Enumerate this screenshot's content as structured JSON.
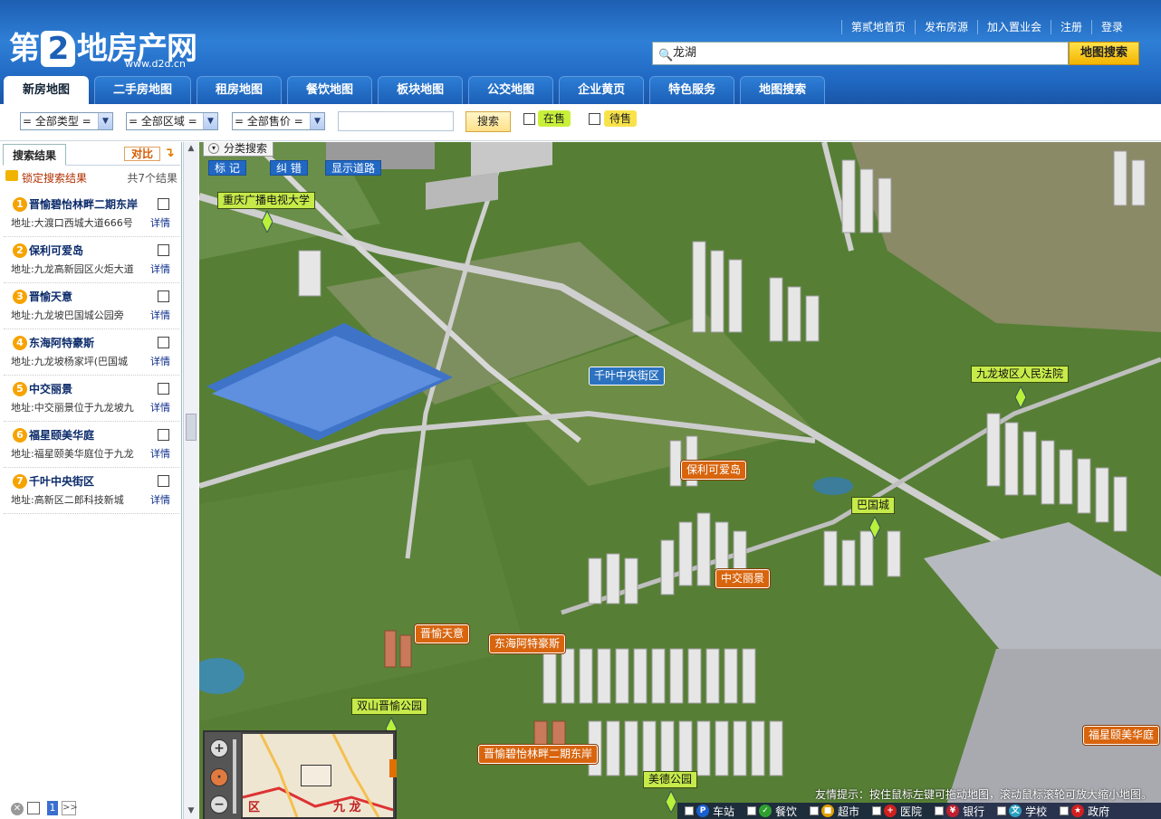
{
  "header": {
    "logo_text_left": "第",
    "logo_text_two": "2",
    "logo_text_right": "地房产网",
    "logo_url": "www.d2d.cn",
    "top_links": [
      "第贰地首页",
      "发布房源",
      "加入置业会",
      "注册",
      "登录"
    ],
    "search_value": "龙湖",
    "search_button": "地图搜索"
  },
  "tabs": [
    {
      "label": "新房地图",
      "active": true
    },
    {
      "label": "二手房地图",
      "active": false
    },
    {
      "label": "租房地图",
      "active": false
    },
    {
      "label": "餐饮地图",
      "active": false
    },
    {
      "label": "板块地图",
      "active": false
    },
    {
      "label": "公交地图",
      "active": false
    },
    {
      "label": "企业黄页",
      "active": false
    },
    {
      "label": "特色服务",
      "active": false
    },
    {
      "label": "地图搜索",
      "active": false
    }
  ],
  "filters": {
    "type_select": "= 全部类型 =",
    "area_select": "= 全部区域 =",
    "price_select": "= 全部售价 =",
    "keyword_value": "",
    "search_label": "搜索",
    "on_sale_label": "在售",
    "pending_label": "待售"
  },
  "left_panel": {
    "tab_label": "搜索结果",
    "compare_label": "对比",
    "lock_label": "锁定搜索结果",
    "count_prefix": "共",
    "count_value": "7",
    "count_suffix": "个结果",
    "detail_label": "详情",
    "results": [
      {
        "num": "1",
        "name": "晋愉碧怡林畔二期东岸",
        "address": "地址:大渡口西城大道666号"
      },
      {
        "num": "2",
        "name": "保利可爱岛",
        "address": "地址:九龙高新园区火炬大道"
      },
      {
        "num": "3",
        "name": "晋愉天意",
        "address": "地址:九龙坡巴国城公园旁"
      },
      {
        "num": "4",
        "name": "东海阿特豪斯",
        "address": "地址:九龙坡杨家坪(巴国城"
      },
      {
        "num": "5",
        "name": "中交丽景",
        "address": "地址:中交丽景位于九龙坡九"
      },
      {
        "num": "6",
        "name": "福星颐美华庭",
        "address": "地址:福星颐美华庭位于九龙"
      },
      {
        "num": "7",
        "name": "千叶中央街区",
        "address": "地址:高新区二郎科技新城"
      }
    ],
    "page_current": "1",
    "page_next": ">>"
  },
  "map": {
    "classify_label": "分类搜索",
    "buttons": [
      "标 记",
      "纠 错",
      "显示道路"
    ],
    "green_labels": [
      "重庆广播电视大学",
      "九龙坡区人民法院",
      "巴国城",
      "双山晋愉公园",
      "美德公园"
    ],
    "orange_labels": [
      "保利可爱岛",
      "中交丽景",
      "晋愉天意",
      "东海阿特豪斯",
      "晋愉碧怡林畔二期东岸",
      "福星颐美华庭"
    ],
    "blue_labels": [
      "千叶中央街区"
    ],
    "tip": "友情提示：按住鼠标左键可拖动地图，滚动鼠标滚轮可放大缩小地图。",
    "minimap_text_1": "区",
    "minimap_text_2": "九 龙",
    "poi": [
      {
        "label": "车站",
        "icon": "P",
        "color": "#1a5fd0"
      },
      {
        "label": "餐饮",
        "icon": "✓",
        "color": "#2fa030"
      },
      {
        "label": "超市",
        "icon": "■",
        "color": "#e0a000"
      },
      {
        "label": "医院",
        "icon": "+",
        "color": "#d02020"
      },
      {
        "label": "银行",
        "icon": "¥",
        "color": "#c02030"
      },
      {
        "label": "学校",
        "icon": "文",
        "color": "#2aa0c0"
      },
      {
        "label": "政府",
        "icon": "★",
        "color": "#d02020"
      }
    ]
  }
}
